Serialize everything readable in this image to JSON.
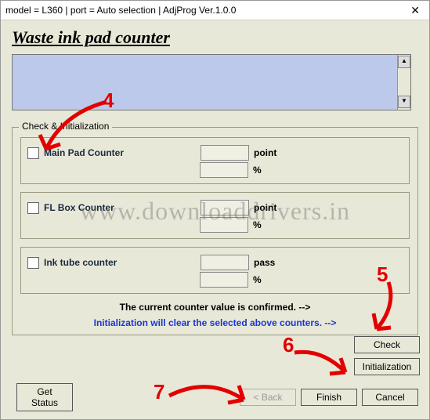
{
  "titlebar": "model = L360 | port = Auto selection | AdjProg Ver.1.0.0",
  "heading": "Waste ink pad counter",
  "group_legend": "Check & Initialization",
  "counters": [
    {
      "name": "Main Pad Counter",
      "unit1": "point",
      "unit2": "%"
    },
    {
      "name": "FL Box Counter",
      "unit1": "point",
      "unit2": "%"
    },
    {
      "name": "Ink tube counter",
      "unit1": "pass",
      "unit2": "%"
    }
  ],
  "msg_confirm": "The current counter value is confirmed. -->",
  "msg_init": "Initialization will clear the selected above counters. -->",
  "buttons": {
    "check": "Check",
    "init": "Initialization",
    "get_status": "Get Status",
    "back": "< Back",
    "finish": "Finish",
    "cancel": "Cancel"
  },
  "annotations": {
    "n4": "4",
    "n5": "5",
    "n6": "6",
    "n7": "7"
  },
  "watermark": "www.downloaddrivers.in"
}
